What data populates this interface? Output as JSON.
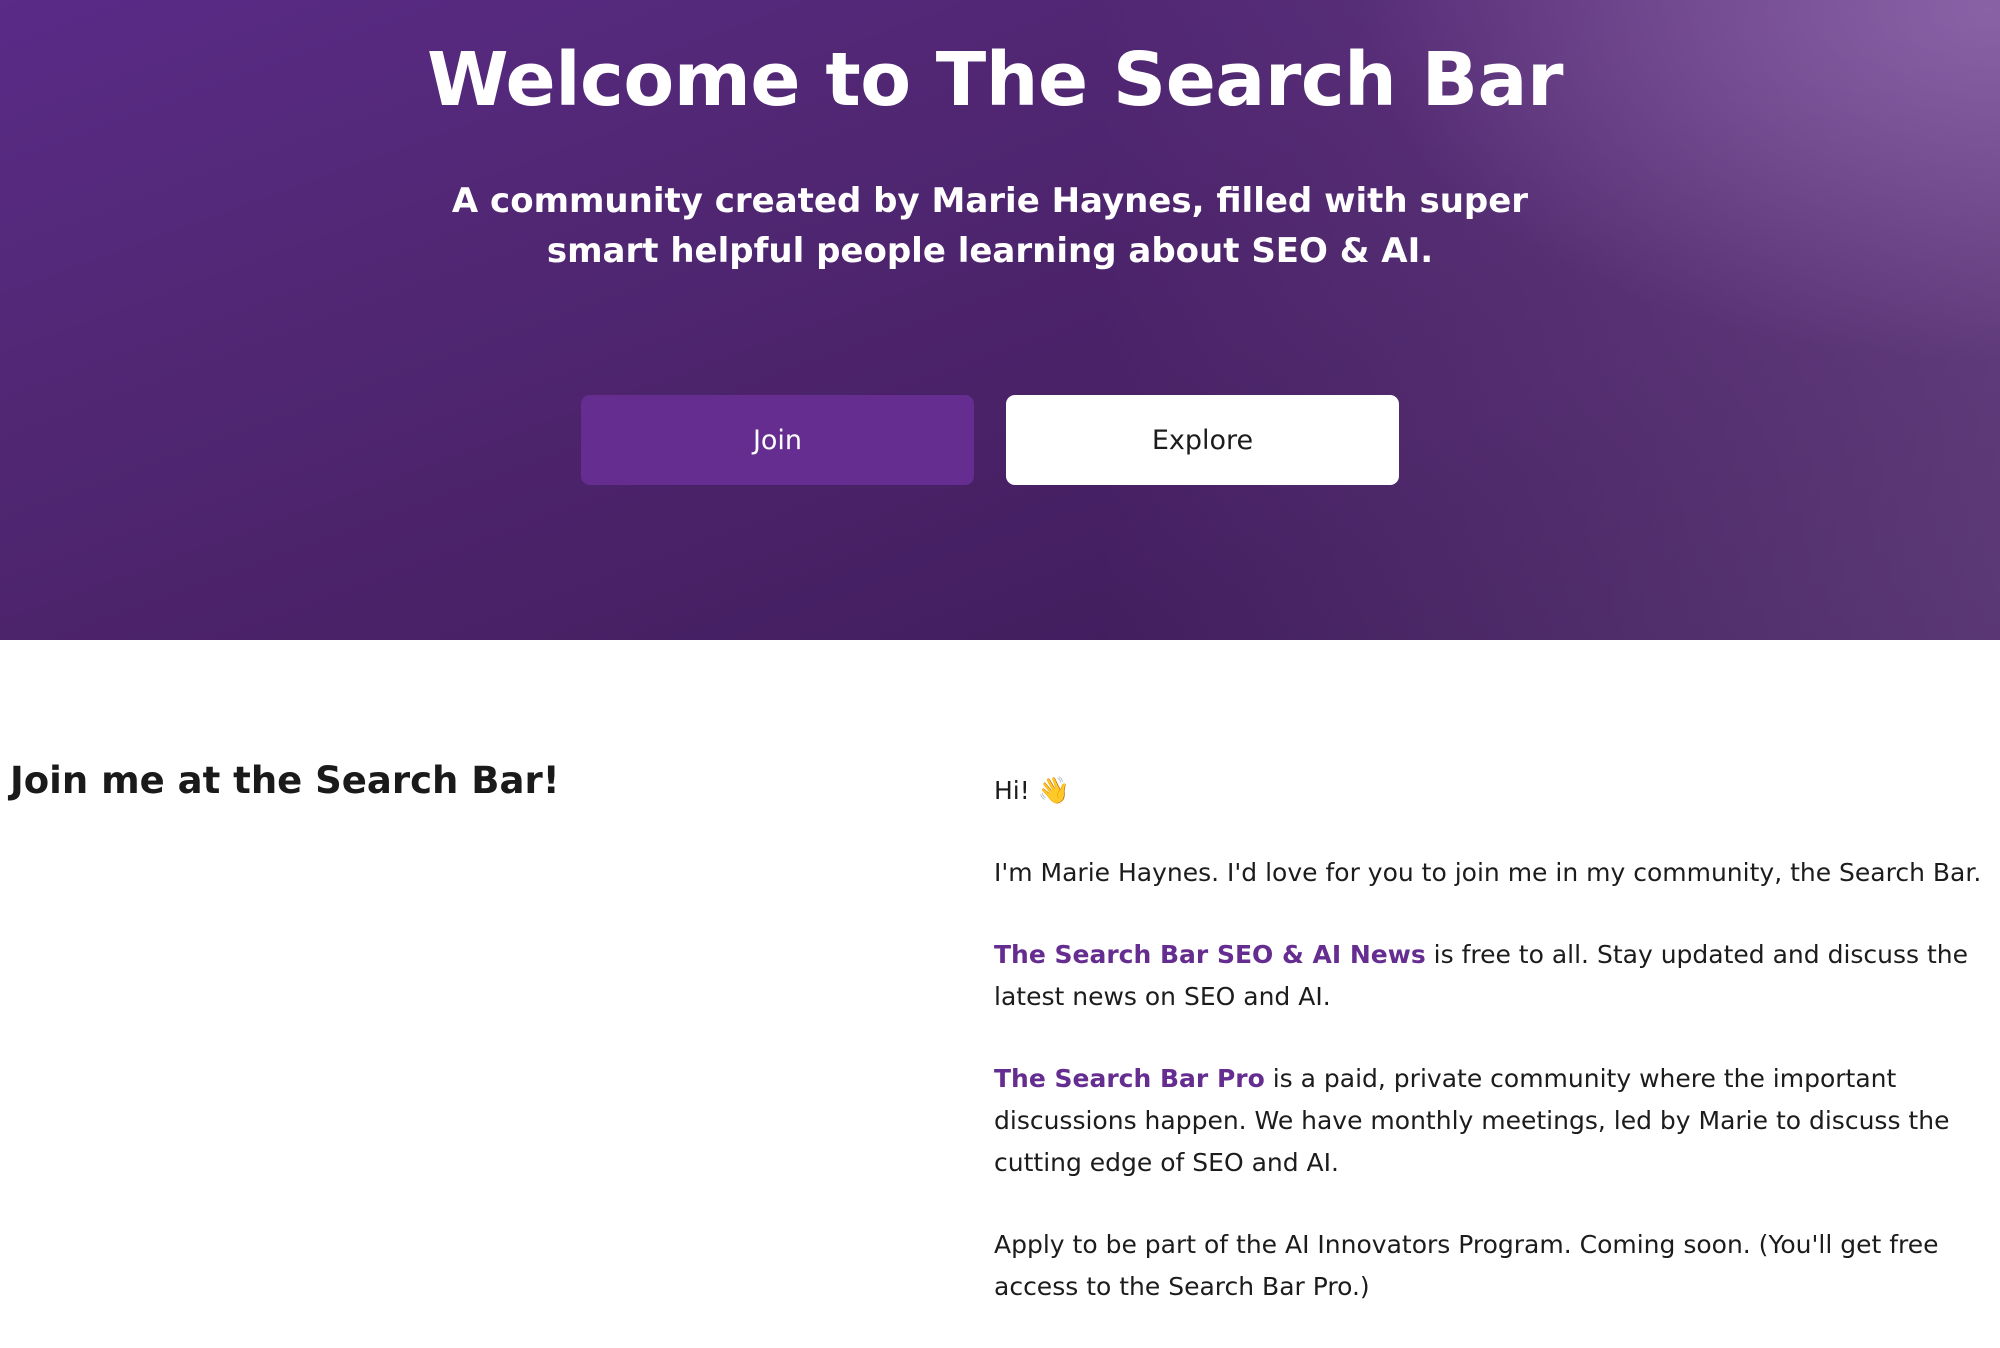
{
  "hero": {
    "title": "Welcome to The Search Bar",
    "subtitle": "A community created by Marie Haynes, filled with super smart helpful people learning about SEO & AI.",
    "join_label": "Join",
    "explore_label": "Explore"
  },
  "section": {
    "heading": "Join me at the Search Bar!"
  },
  "content": {
    "greeting": "Hi!",
    "greeting_emoji": "👋",
    "intro": "I'm Marie Haynes. I'd love for you to join me in my community, the Search Bar.",
    "news_link": "The Search Bar SEO & AI News",
    "news_text": " is free to all. Stay updated and discuss the latest news on SEO and AI.",
    "pro_link": "The Search Bar Pro",
    "pro_text": " is a paid, private community where the important discussions happen. We have monthly meetings, led by Marie to discuss the cutting edge of SEO and AI.",
    "apply_text": "Apply to be part of the AI Innovators Program. Coming soon. (You'll get free access to the Search Bar Pro.)"
  },
  "colors": {
    "brand_purple": "#662d91",
    "hero_dark": "#3a1a55",
    "hero_light": "#8c64aa"
  }
}
